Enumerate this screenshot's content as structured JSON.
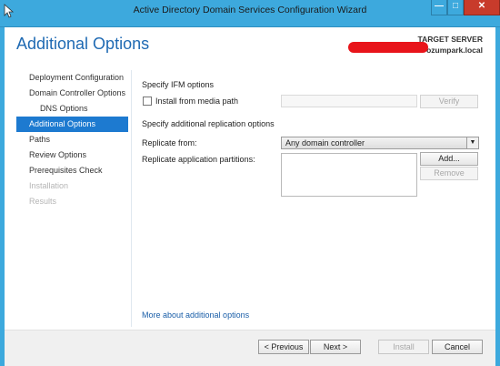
{
  "window": {
    "title": "Active Directory Domain Services Configuration Wizard",
    "controls": {
      "minimize": "—",
      "maximize": "□",
      "close": "✕"
    }
  },
  "header": {
    "page_title": "Additional Options",
    "target_label": "TARGET SERVER",
    "target_name": "ozumpark.local"
  },
  "nav": {
    "items": [
      {
        "label": "Deployment Configuration",
        "state": "normal"
      },
      {
        "label": "Domain Controller Options",
        "state": "normal"
      },
      {
        "label": "DNS Options",
        "state": "normal"
      },
      {
        "label": "Additional Options",
        "state": "active"
      },
      {
        "label": "Paths",
        "state": "normal"
      },
      {
        "label": "Review Options",
        "state": "normal"
      },
      {
        "label": "Prerequisites Check",
        "state": "normal"
      },
      {
        "label": "Installation",
        "state": "disabled"
      },
      {
        "label": "Results",
        "state": "disabled"
      }
    ]
  },
  "ifm": {
    "heading": "Specify IFM options",
    "checkbox_label": "Install from media path",
    "checked": false,
    "path_value": "",
    "verify_label": "Verify"
  },
  "replication": {
    "heading": "Specify additional replication options",
    "replicate_from_label": "Replicate from:",
    "replicate_from_value": "Any domain controller",
    "partitions_label": "Replicate application partitions:",
    "add_label": "Add...",
    "remove_label": "Remove"
  },
  "more_link": "More about additional options",
  "footer": {
    "previous": "< Previous",
    "next": "Next >",
    "install": "Install",
    "cancel": "Cancel"
  },
  "colors": {
    "titlebar": "#3da9dd",
    "accent": "#1d7ad0",
    "page_title": "#1f6ab3",
    "close_button": "#c83b2b",
    "redaction": "#e8141a"
  }
}
